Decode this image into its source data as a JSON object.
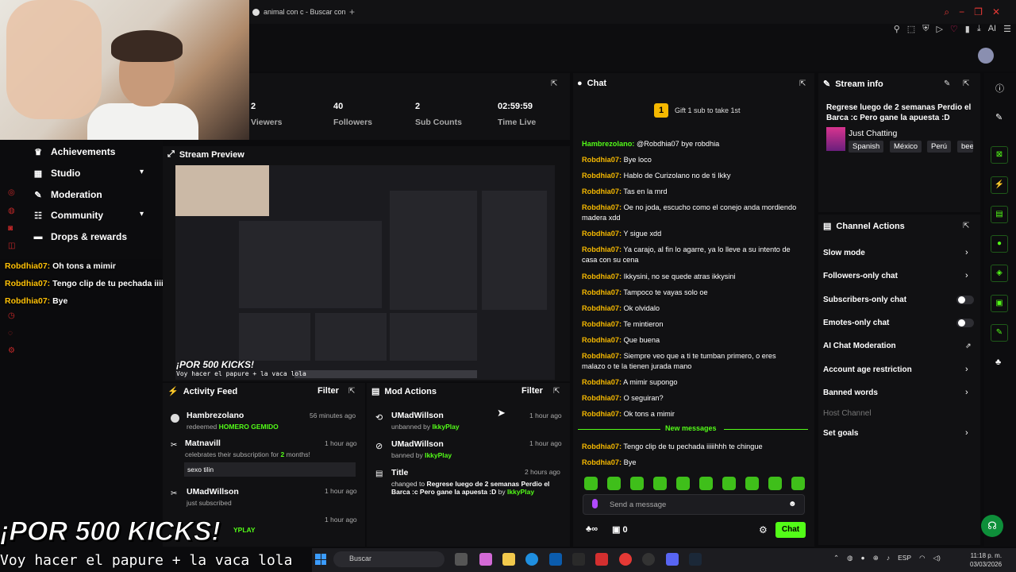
{
  "browser": {
    "tab_title": "animal con c - Buscar con",
    "new_tab": "+"
  },
  "stats": [
    {
      "value": "2",
      "label": "Viewers"
    },
    {
      "value": "40",
      "label": "Followers"
    },
    {
      "value": "2",
      "label": "Sub Counts"
    },
    {
      "value": "02:59:59",
      "label": "Time Live"
    }
  ],
  "nav": {
    "items": [
      {
        "label": "Achievements",
        "icon": "trophy-icon"
      },
      {
        "label": "Studio",
        "icon": "studio-icon"
      },
      {
        "label": "Moderation",
        "icon": "wrench-icon"
      },
      {
        "label": "Community",
        "icon": "people-icon"
      },
      {
        "label": "Drops & rewards",
        "icon": "gift-icon"
      }
    ]
  },
  "overlay_chat": [
    {
      "user": "Robdhia07:",
      "text": "Oh tons a mimir"
    },
    {
      "user": "Robdhia07:",
      "text": "Tengo clip de tu pechada iiiiihhh te chingue"
    },
    {
      "user": "Robdhia07:",
      "text": "Bye"
    }
  ],
  "preview": {
    "title": "Stream Preview",
    "promo": "¡POR 500 KICKS!",
    "promo_sub": "Voy hacer el papure + la vaca lola"
  },
  "activity": {
    "title": "Activity Feed",
    "filter": "Filter",
    "rows": [
      {
        "who": "Hambrezolano",
        "what": "redeemed",
        "highlight": "HOMERO GEMIDO",
        "time": "56 minutes ago"
      },
      {
        "who": "Matnavill",
        "what": "celebrates their subscription for",
        "highlight": "2",
        "tail": "months!",
        "time": "1 hour ago",
        "message": "sexo tilin"
      },
      {
        "who": "UMadWillson",
        "what": "just subscribed",
        "time": "1 hour ago"
      },
      {
        "who": "",
        "what": "YPLAY",
        "time": "1 hour ago"
      }
    ]
  },
  "mod": {
    "title": "Mod Actions",
    "filter": "Filter",
    "rows": [
      {
        "who": "UMadWillson",
        "what": "unbanned by",
        "by": "IkkyPlay",
        "time": "1 hour ago"
      },
      {
        "who": "UMadWillson",
        "what": "banned by",
        "by": "IkkyPlay",
        "time": "1 hour ago"
      },
      {
        "who": "Title",
        "what": "changed to",
        "detail": "Regrese luego de 2 semanas Perdio el Barca :c Pero gane la apuesta :D",
        "by_prefix": "by",
        "by": "IkkyPlay",
        "time": "2 hours ago"
      }
    ]
  },
  "chat": {
    "title": "Chat",
    "gift_badge": "1",
    "gift_text": "Gift 1 sub to take 1st",
    "messages": [
      {
        "user": "Hambrezolano:",
        "text": "@Robdhia07 bye robdhia",
        "green": true
      },
      {
        "user": "Robdhia07:",
        "text": "Bye loco"
      },
      {
        "user": "Robdhia07:",
        "text": "Hablo de Curizolano no de ti Ikky"
      },
      {
        "user": "Robdhia07:",
        "text": "Tas en la mrd"
      },
      {
        "user": "Robdhia07:",
        "text": "Oe no joda, escucho como el conejo anda mordiendo madera xdd"
      },
      {
        "user": "Robdhia07:",
        "text": "Y sigue xdd"
      },
      {
        "user": "Robdhia07:",
        "text": "Ya carajo, al fin lo agarre, ya lo lleve a su intento de casa con su cena"
      },
      {
        "user": "Robdhia07:",
        "text": "Ikkysini, no se quede atras ikkysini"
      },
      {
        "user": "Robdhia07:",
        "text": "Tampoco te vayas solo oe"
      },
      {
        "user": "Robdhia07:",
        "text": "Ok olvidalo"
      },
      {
        "user": "Robdhia07:",
        "text": "Te mintieron"
      },
      {
        "user": "Robdhia07:",
        "text": "Que buena"
      },
      {
        "user": "Robdhia07:",
        "text": "Siempre veo que a ti te tumban primero, o eres malazo o te la tienen jurada mano"
      },
      {
        "user": "Robdhia07:",
        "text": "A mimir supongo"
      },
      {
        "user": "Robdhia07:",
        "text": "O seguiran?"
      },
      {
        "user": "Robdhia07:",
        "text": "Ok tons a mimir"
      }
    ],
    "new_messages_label": "New messages",
    "new_messages": [
      {
        "user": "Robdhia07:",
        "text": "Tengo clip de tu pechada iiiiihhh te chingue"
      },
      {
        "user": "Robdhia07:",
        "text": "Bye"
      }
    ],
    "placeholder": "Send a message",
    "points": "0",
    "send_label": "Chat"
  },
  "stream_info": {
    "title": "Stream info",
    "stream_title": "Regrese luego de 2 semanas Perdio el Barca :c Pero gane la apuesta :D",
    "category": "Just Chatting",
    "tags": [
      "Spanish",
      "México",
      "Perú",
      "bee"
    ]
  },
  "channel_actions": {
    "title": "Channel Actions",
    "items": [
      {
        "label": "Slow mode",
        "control": "chevron"
      },
      {
        "label": "Followers-only chat",
        "control": "chevron"
      },
      {
        "label": "Subscribers-only chat",
        "control": "toggle",
        "on": false
      },
      {
        "label": "Emotes-only chat",
        "control": "toggle",
        "on": false
      },
      {
        "label": "AI Chat Moderation",
        "control": "external"
      },
      {
        "label": "Account age restriction",
        "control": "chevron"
      },
      {
        "label": "Banned words",
        "control": "chevron"
      },
      {
        "label": "Host Channel",
        "control": "none",
        "disabled": true
      },
      {
        "label": "Set goals",
        "control": "chevron"
      }
    ]
  },
  "promo": {
    "big": "¡POR 500 KICKS!",
    "sub": "Voy hacer el papure + la vaca lola"
  },
  "taskbar": {
    "search": "Buscar",
    "lang": "ESP",
    "time": "11:18 p. m.",
    "date": "03/03/2026"
  },
  "colors": {
    "accent": "#53fc18",
    "username": "#f5b800",
    "panel": "#111113"
  }
}
